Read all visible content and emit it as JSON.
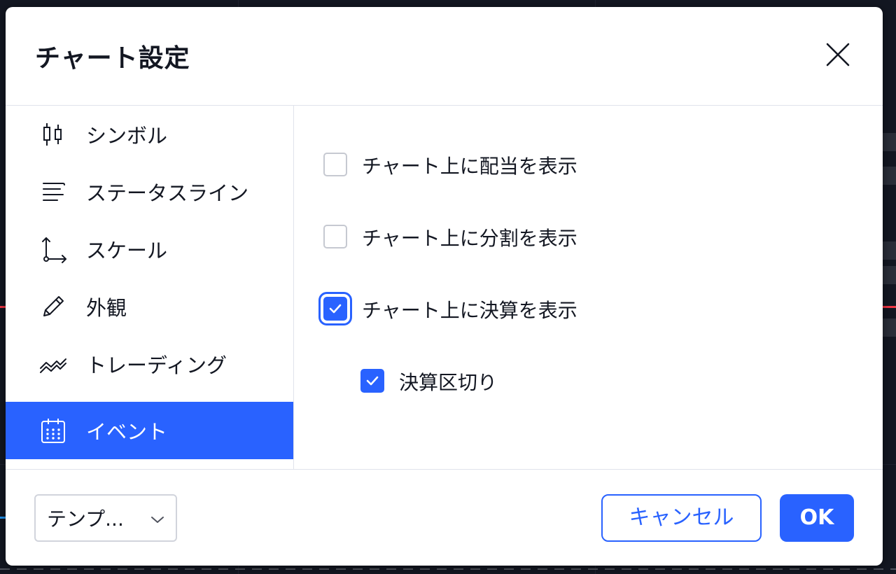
{
  "dialog": {
    "title": "チャート設定",
    "close_icon": "close-icon"
  },
  "sidebar": {
    "items": [
      {
        "label": "シンボル",
        "icon": "candlestick-icon",
        "active": false
      },
      {
        "label": "ステータスライン",
        "icon": "status-line-icon",
        "active": false
      },
      {
        "label": "スケール",
        "icon": "scale-axes-icon",
        "active": false
      },
      {
        "label": "外観",
        "icon": "pencil-icon",
        "active": false
      },
      {
        "label": "トレーディング",
        "icon": "trading-icon",
        "active": false
      },
      {
        "label": "イベント",
        "icon": "calendar-icon",
        "active": true
      }
    ]
  },
  "content": {
    "options": [
      {
        "label": "チャート上に配当を表示",
        "checked": false
      },
      {
        "label": "チャート上に分割を表示",
        "checked": false
      },
      {
        "label": "チャート上に決算を表示",
        "checked": true,
        "focused": true
      },
      {
        "label": "決算区切り",
        "checked": true,
        "indented": true
      }
    ]
  },
  "footer": {
    "template_label": "テンプ...",
    "cancel_label": "キャンセル",
    "ok_label": "OK"
  },
  "colors": {
    "accent": "#2962ff",
    "backdrop": "#131722",
    "text": "#131722",
    "border": "#e0e3eb"
  }
}
